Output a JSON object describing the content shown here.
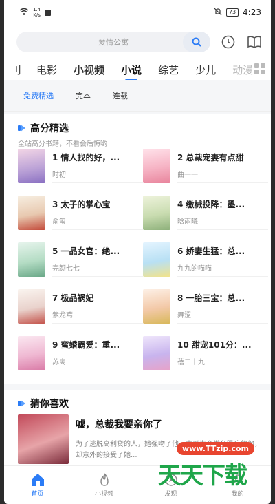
{
  "status": {
    "speed": "1.4\nK/s",
    "battery": "73",
    "time": "4:23"
  },
  "search": {
    "placeholder": "爱情公寓"
  },
  "channels": [
    "刂",
    "电影",
    "小视频",
    "小说",
    "综艺",
    "少儿",
    "动漫"
  ],
  "subtabs": [
    "免费精选",
    "完本",
    "连载"
  ],
  "section1": {
    "title": "高分精选",
    "subtitle": "全站高分书籍，不看会后悔哟",
    "books": [
      {
        "title": "1 情人找的好，...",
        "author": "时初"
      },
      {
        "title": "2 总裁宠妻有点甜",
        "author": "曲一一"
      },
      {
        "title": "3 太子的掌心宝",
        "author": "俞玺"
      },
      {
        "title": "4 缴械投降：墨...",
        "author": "晗雨曦"
      },
      {
        "title": "5 一品女官：绝...",
        "author": "完颜七七"
      },
      {
        "title": "6 娇妻生猛：总...",
        "author": "九九的喵喵"
      },
      {
        "title": "7 极品祸妃",
        "author": "紫龙鸢"
      },
      {
        "title": "8 一胎三宝：总...",
        "author": "舞涩"
      },
      {
        "title": "9 蜜婚霸爱：重...",
        "author": "苏离"
      },
      {
        "title": "10 甜宠101分：...",
        "author": "蓓二十九"
      }
    ]
  },
  "section2": {
    "title": "猜你喜欢",
    "book_title": "嘘，总裁我要亲你了",
    "book_desc": "为了逃脱高利贷的人，她强吻了他。本以为会发狂躁症的他，却意外的接受了她..."
  },
  "tabbar": [
    "首页",
    "小视频",
    "发现",
    "我的"
  ],
  "watermark": {
    "url": "www.TTzip.com",
    "text": "天天下载"
  },
  "colors": {
    "accent": "#2b7cf6"
  }
}
